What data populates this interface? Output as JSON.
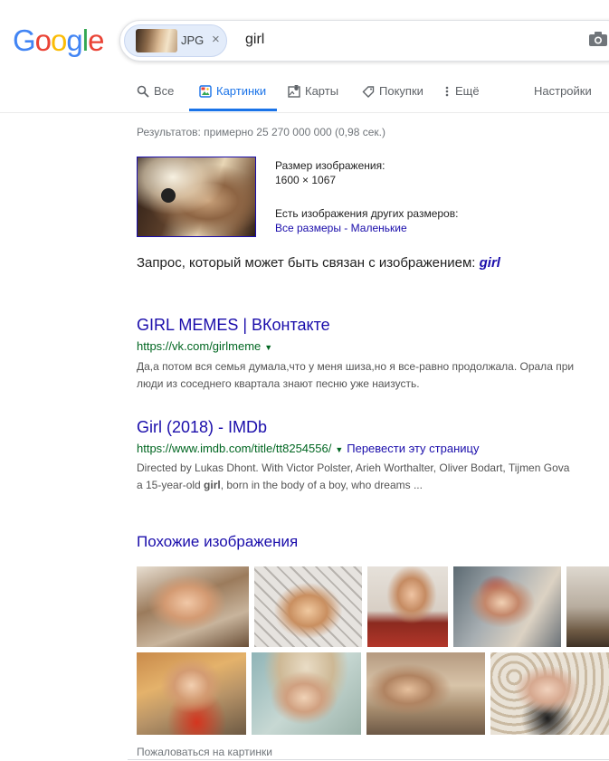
{
  "logo": {
    "letters": [
      "G",
      "o",
      "o",
      "g",
      "l",
      "e"
    ]
  },
  "search": {
    "chip_label": "JPG",
    "chip_close": "×",
    "query": "girl"
  },
  "tabs": [
    {
      "label": "Все",
      "icon": "search-icon"
    },
    {
      "label": "Картинки",
      "icon": "image-icon",
      "active": true
    },
    {
      "label": "Карты",
      "icon": "map-icon"
    },
    {
      "label": "Покупки",
      "icon": "tag-icon"
    },
    {
      "label": "Ещё",
      "icon": "more-vert-icon"
    },
    {
      "label": "Настройки"
    }
  ],
  "stats": "Результатов: примерно 25 270 000 000 (0,98 сек.)",
  "image_info": {
    "size_label": "Размер изображения:",
    "size_value": "1600 × 1067",
    "other_sizes_label": "Есть изображения других размеров:",
    "all_sizes": "Все размеры",
    "separator": "-",
    "small": "Маленькие"
  },
  "related": {
    "label": "Запрос, который может быть связан с изображением:",
    "term": "girl"
  },
  "results": [
    {
      "title": "GIRL MEMES | ВКонтакте",
      "url": "https://vk.com/girlmeme",
      "snippet_line1": "Да,а потом вся семья думала,что у меня шиза,но я все-равно продолжала. Орала при",
      "snippet_line2": "люди из соседнего квартала знают песню уже наизусть."
    },
    {
      "title": "Girl (2018) - IMDb",
      "url": "https://www.imdb.com/title/tt8254556/",
      "translate": "Перевести эту страницу",
      "snippet_line1": "Directed by Lukas Dhont. With Victor Polster, Arieh Worthalter, Oliver Bodart, Tijmen Gova",
      "snippet_line2_pre": "a 15-year-old ",
      "snippet_line2_bold": "girl",
      "snippet_line2_post": ", born in the body of a boy, who dreams ..."
    }
  ],
  "similar": {
    "title": "Похожие изображения",
    "report": "Пожаловаться на картинки"
  },
  "colors": {
    "link": "#1a0dab",
    "url_green": "#006621",
    "accent": "#1a73e8"
  }
}
